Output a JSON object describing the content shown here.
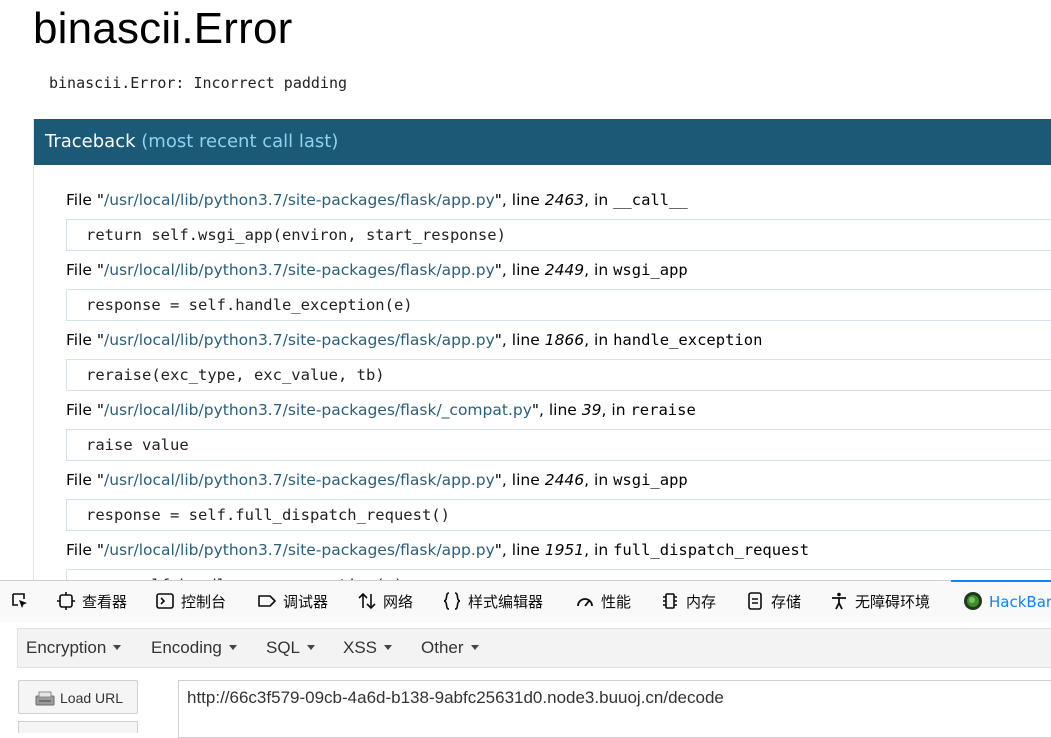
{
  "error": {
    "title": "binascii.Error",
    "message": "binascii.Error: Incorrect padding"
  },
  "traceback": {
    "header_main": "Traceback",
    "header_sub": "(most recent call last)",
    "frames": [
      {
        "file": "/usr/local/lib/python3.7/site-packages/flask/app.py",
        "line": "2463",
        "func": "__call__",
        "code": "return self.wsgi_app(environ, start_response)"
      },
      {
        "file": "/usr/local/lib/python3.7/site-packages/flask/app.py",
        "line": "2449",
        "func": "wsgi_app",
        "code": "response = self.handle_exception(e)"
      },
      {
        "file": "/usr/local/lib/python3.7/site-packages/flask/app.py",
        "line": "1866",
        "func": "handle_exception",
        "code": "reraise(exc_type, exc_value, tb)"
      },
      {
        "file": "/usr/local/lib/python3.7/site-packages/flask/_compat.py",
        "line": "39",
        "func": "reraise",
        "code": "raise value"
      },
      {
        "file": "/usr/local/lib/python3.7/site-packages/flask/app.py",
        "line": "2446",
        "func": "wsgi_app",
        "code": "response = self.full_dispatch_request()"
      },
      {
        "file": "/usr/local/lib/python3.7/site-packages/flask/app.py",
        "line": "1951",
        "func": "full_dispatch_request",
        "code": "rv = self.handle_user_exception(e)"
      }
    ],
    "labels": {
      "file": "File",
      "line": "line",
      "in": "in"
    }
  },
  "devtools": {
    "tabs": [
      "查看器",
      "控制台",
      "调试器",
      "网络",
      "样式编辑器",
      "性能",
      "内存",
      "存储",
      "无障碍环境",
      "HackBar"
    ],
    "icons": [
      "inspector-pick-icon",
      "inspector-icon",
      "console-icon",
      "debugger-icon",
      "network-icon",
      "style-editor-icon",
      "performance-icon",
      "memory-icon",
      "storage-icon",
      "accessibility-icon",
      "hackbar-icon"
    ],
    "active_tab": "HackBar",
    "accent_color": "#0a84ff"
  },
  "hackbar": {
    "menu": [
      "Encryption",
      "Encoding",
      "SQL",
      "XSS",
      "Other"
    ],
    "load_url_label": "Load URL",
    "url": "http://66c3f579-09cb-4a6d-b138-9abfc25631d0.node3.buuoj.cn/decode"
  },
  "colors": {
    "traceback_header_bg": "#1c5977",
    "traceback_header_sub": "#8fd1ee",
    "path_color": "#2a5f7d"
  }
}
